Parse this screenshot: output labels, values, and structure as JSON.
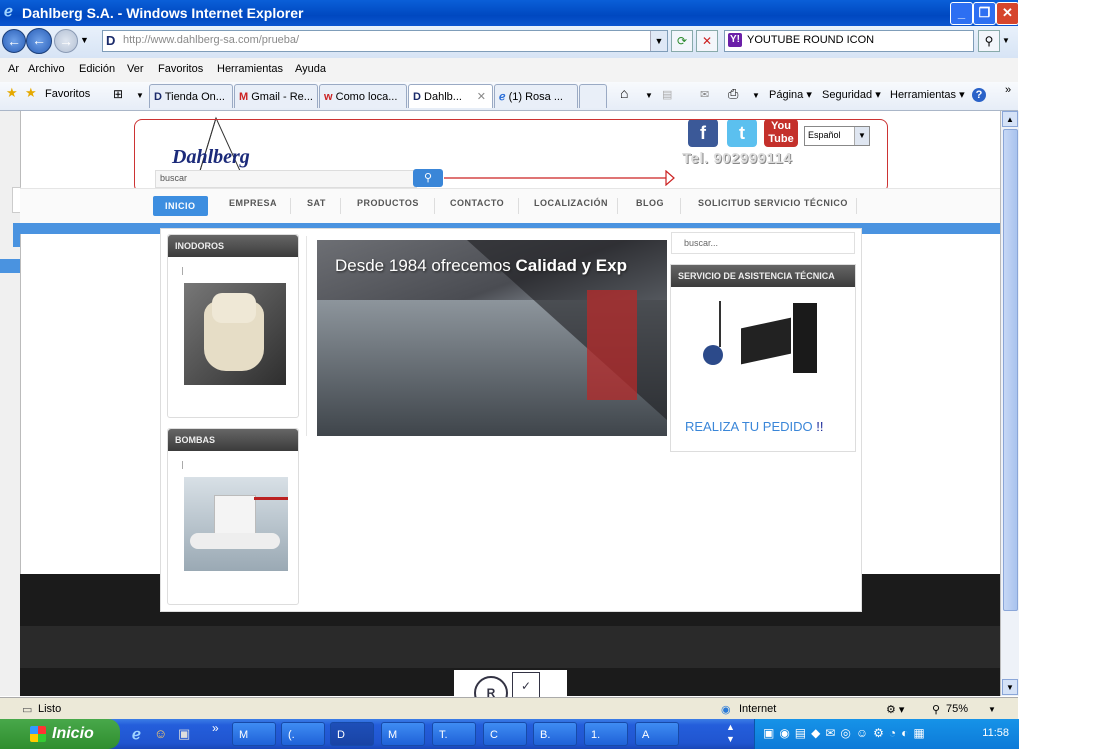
{
  "window": {
    "title": "Dahlberg S.A. - Windows Internet Explorer",
    "minimize_icon": "minimize-icon",
    "maximize_icon": "restore-icon",
    "close_icon": "close-icon"
  },
  "addressbar": {
    "url": "http://www.dahlberg-sa.com/prueba/",
    "search_query": "YOUTUBE ROUND ICON"
  },
  "menu": [
    "Ar",
    "Archivo",
    "Edición",
    "Ver",
    "Favoritos",
    "Herramientas",
    "Ayuda"
  ],
  "favorites": {
    "label": "Favoritos",
    "tabs": [
      "Tienda On...",
      "Gmail - Re...",
      "Como loca...",
      "Dahlb...",
      "(1) Rosa ..."
    ],
    "tools": [
      "Página",
      "Seguridad",
      "Herramientas"
    ]
  },
  "site": {
    "logo_text": "Dahlberg",
    "search_placeholder": "buscar",
    "language": "Español",
    "phone": "Tel. 902999114",
    "social": [
      "facebook",
      "twitter",
      "youtube"
    ],
    "youtube_label": "You Tube",
    "nav": [
      "INICIO",
      "EMPRESA",
      "SAT",
      "PRODUCTOS",
      "CONTACTO",
      "LOCALIZACIÓN",
      "BLOG",
      "SOLICITUD SERVICIO TÉCNICO"
    ],
    "categories": [
      {
        "title": "INODOROS"
      },
      {
        "title": "BOMBAS"
      }
    ],
    "banner_text": "Desde 1984 ofrecemos ",
    "banner_bold": "Calidad y Exp",
    "right_search_placeholder": "buscar...",
    "service_title": "SERVICIO DE ASISTENCIA TÉCNICA",
    "order_text": "REALIZA TU PEDIDO",
    "order_marks": "!!"
  },
  "status": {
    "text": "Listo",
    "zone": "Internet",
    "zoom": "75%"
  },
  "taskbar": {
    "start": "Inicio",
    "buttons": [
      "M",
      "(.",
      "D",
      "M",
      "T.",
      "C",
      "B.",
      "1.",
      "A"
    ],
    "clock": "11:58"
  },
  "colors": {
    "accent": "#3d8ee0",
    "title_bar": "#0048c0",
    "brand": "#1b2a7a"
  }
}
